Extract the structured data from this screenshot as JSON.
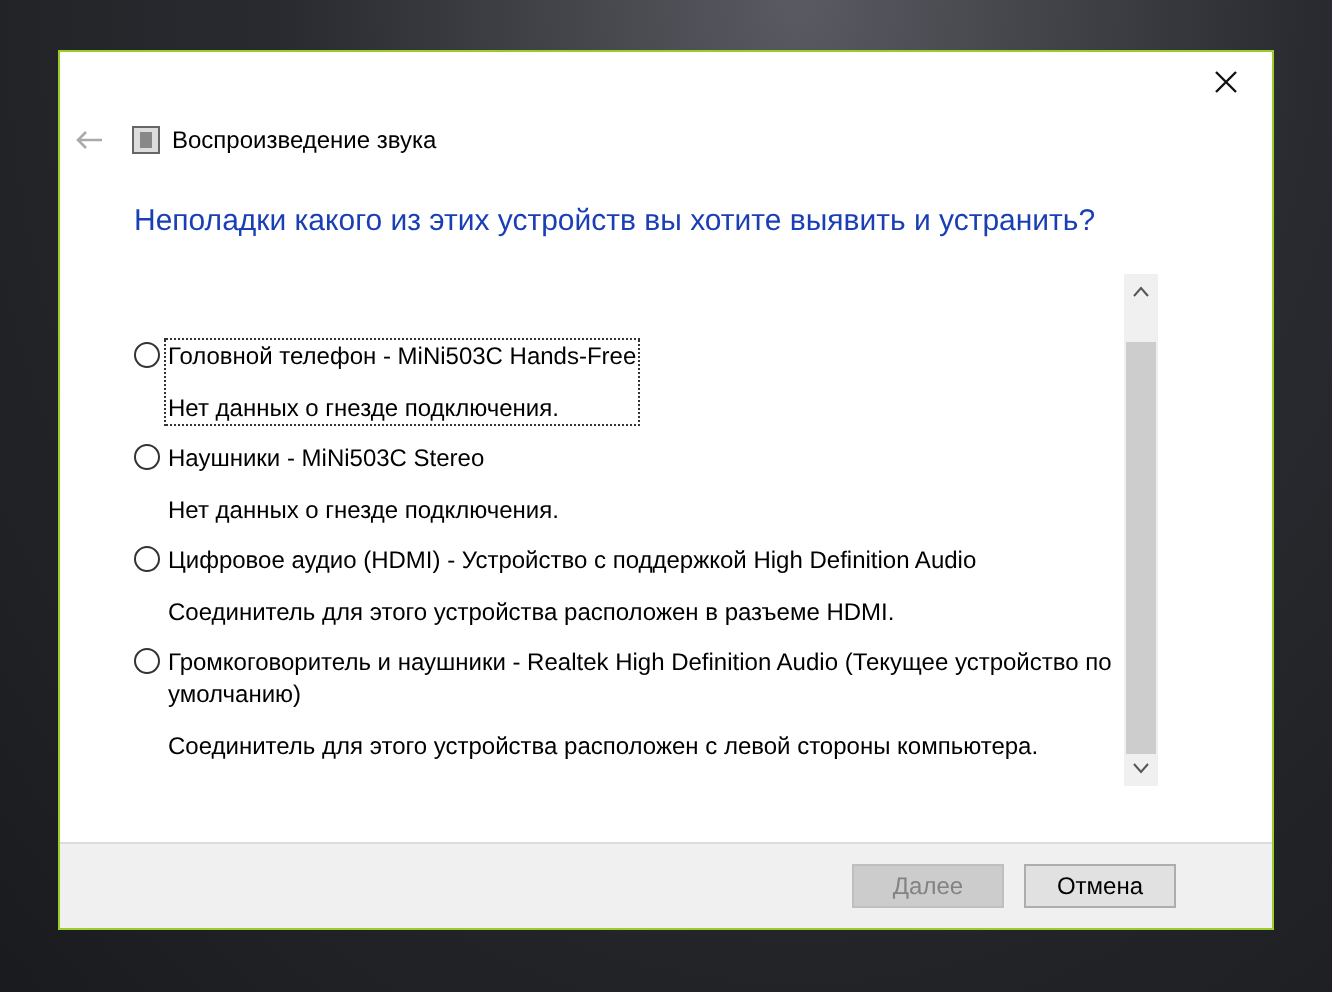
{
  "window": {
    "title": "Воспроизведение звука"
  },
  "question": "Неполадки какого из этих устройств вы хотите выявить и устранить?",
  "devices": [
    {
      "name": "Головной телефон - MiNi503C Hands-Free",
      "note": "Нет данных о гнезде подключения.",
      "selected": false,
      "focused": true
    },
    {
      "name": "Наушники - MiNi503C Stereo",
      "note": "Нет данных о гнезде подключения.",
      "selected": false,
      "focused": false
    },
    {
      "name": "Цифровое аудио (HDMI) - Устройство с поддержкой High Definition Audio",
      "note": "Соединитель для этого устройства расположен в разъеме HDMI.",
      "selected": false,
      "focused": false
    },
    {
      "name": "Громкоговоритель и наушники - Realtek High Definition Audio (Текущее устройство по умолчанию)",
      "note": "Соединитель для этого устройства расположен с левой стороны компьютера.",
      "selected": false,
      "focused": false
    }
  ],
  "buttons": [
    {
      "label": "Далее",
      "disabled": true
    },
    {
      "label": "Отмена",
      "disabled": false
    }
  ]
}
